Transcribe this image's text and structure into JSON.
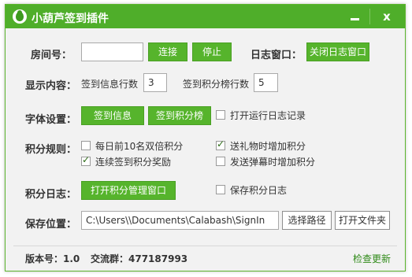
{
  "window": {
    "title": "小葫芦签到插件",
    "min_glyph": "",
    "close_glyph": "x"
  },
  "room": {
    "label": "房间号：",
    "value": "",
    "connect": "连接",
    "stop": "停止"
  },
  "log_window": {
    "label": "日志窗口：",
    "button": "关闭日志窗口"
  },
  "display": {
    "label": "显示内容：",
    "sign_rows_label": "签到信息行数",
    "sign_rows_value": "3",
    "points_rows_label": "签到积分榜行数",
    "points_rows_value": "5"
  },
  "font": {
    "label": "字体设置：",
    "sign_info": "签到信息",
    "points_board": "签到积分榜",
    "run_log_label": "打开运行日志记录",
    "run_log_checked": false
  },
  "rules": {
    "label": "积分规则：",
    "items": [
      {
        "label": "每日前10名双倍积分",
        "checked": false
      },
      {
        "label": "送礼物时增加积分",
        "checked": true
      },
      {
        "label": "连续签到积分奖励",
        "checked": true
      },
      {
        "label": "发送弹幕时增加积分",
        "checked": false
      }
    ]
  },
  "points_log": {
    "label": "积分日志：",
    "button": "打开积分管理窗口",
    "save_label": "保存积分日志",
    "save_checked": false
  },
  "save_location": {
    "label": "保存位置：",
    "path": "C:\\Users\\\\Documents\\Calabash\\SignIn",
    "browse": "选择路径",
    "open_folder": "打开文件夹"
  },
  "footer": {
    "version": "版本号：1.0",
    "group": "交流群：477187993",
    "check_update": "检查更新"
  },
  "colors": {
    "accent": "#4fae2a",
    "button": "#56b42c"
  }
}
